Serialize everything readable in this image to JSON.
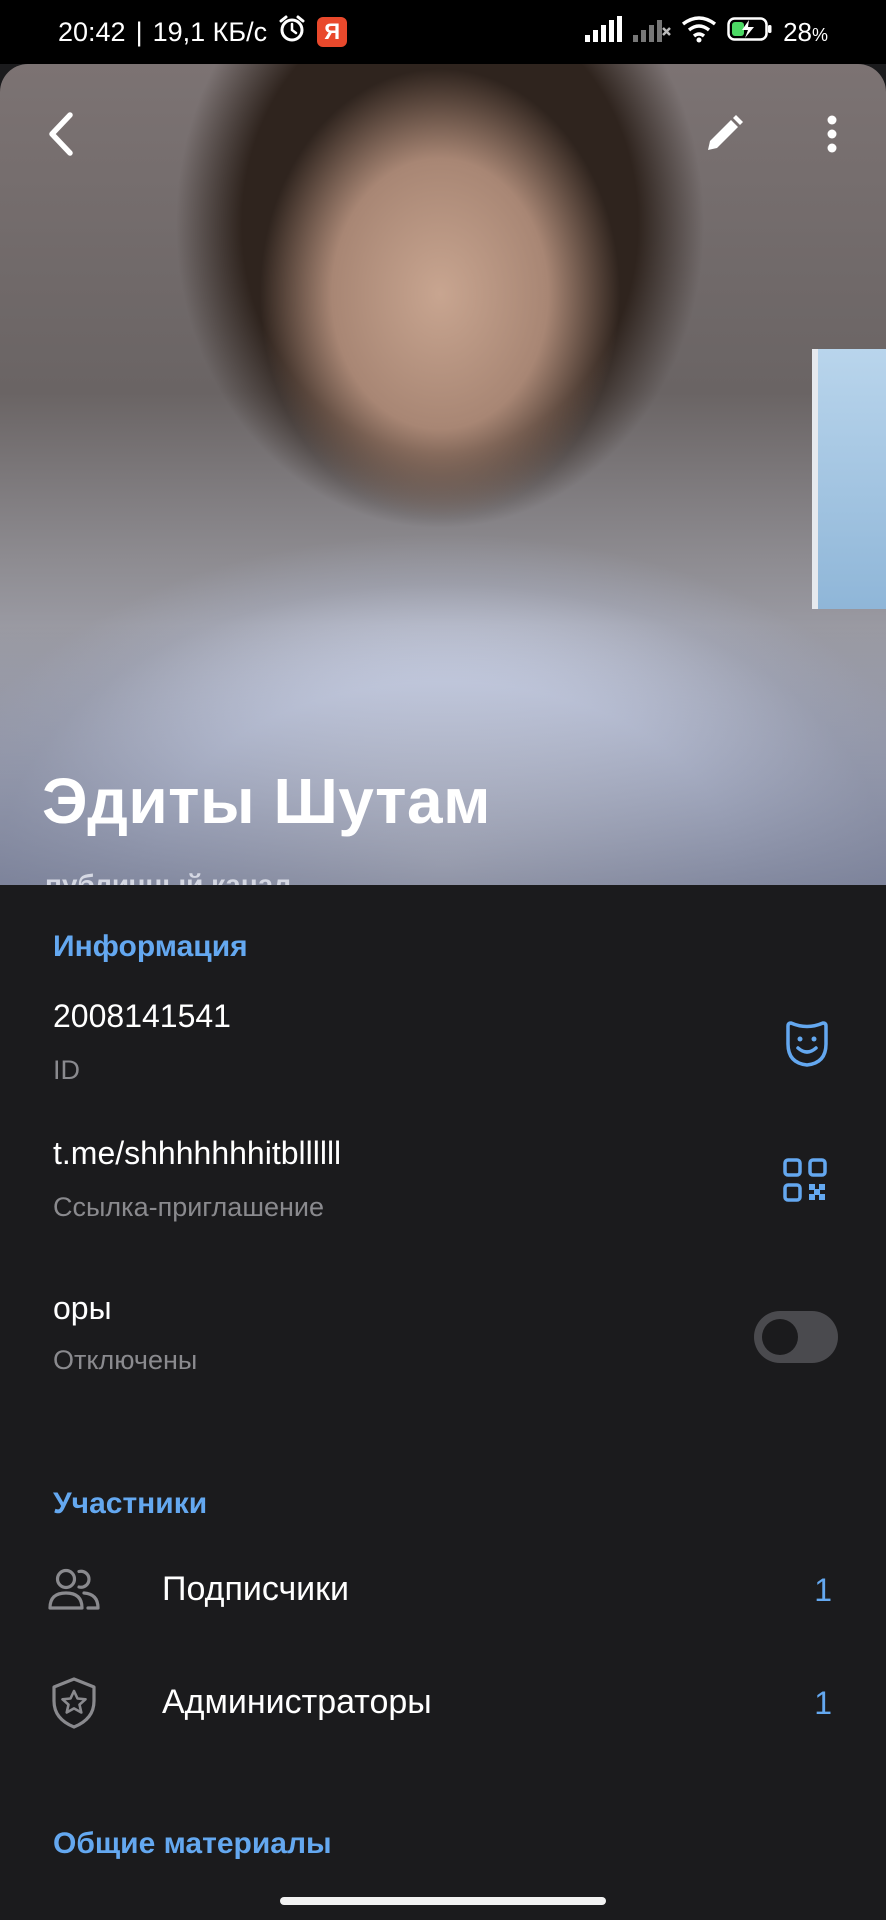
{
  "status_bar": {
    "time": "20:42",
    "separator": "|",
    "network_speed": "19,1 КБ/с",
    "yandex_badge": "Я",
    "battery_percent": "28",
    "battery_unit": "%",
    "icons": [
      "alarm-icon",
      "signal-icon",
      "signal-empty-icon",
      "wifi-icon",
      "battery-charging-icon"
    ]
  },
  "header": {
    "title": "Эдиты Шутам",
    "subtitle": "публичный канал",
    "icons": [
      "back-arrow-icon",
      "edit-pencil-icon",
      "more-vertical-icon"
    ]
  },
  "info_section": {
    "header": "Информация",
    "rows": [
      {
        "value": "2008141541",
        "label": "ID",
        "icon": "emoji-face-icon"
      },
      {
        "value": "t.me/shhhhhhhitbllllll",
        "label": "Ссылка-приглашение",
        "icon": "qr-code-icon"
      },
      {
        "value": "оры",
        "label": "Отключены",
        "icon": "toggle-switch",
        "toggle_on": false
      }
    ]
  },
  "members_section": {
    "header": "Участники",
    "rows": [
      {
        "label": "Подписчики",
        "count": "1",
        "icon": "users-icon"
      },
      {
        "label": "Администраторы",
        "count": "1",
        "icon": "shield-star-icon"
      }
    ]
  },
  "shared_section": {
    "header": "Общие материалы"
  },
  "colors": {
    "accent": "#64a8f0",
    "background": "#1b1b1d",
    "secondary_text": "#8a8a8e"
  }
}
